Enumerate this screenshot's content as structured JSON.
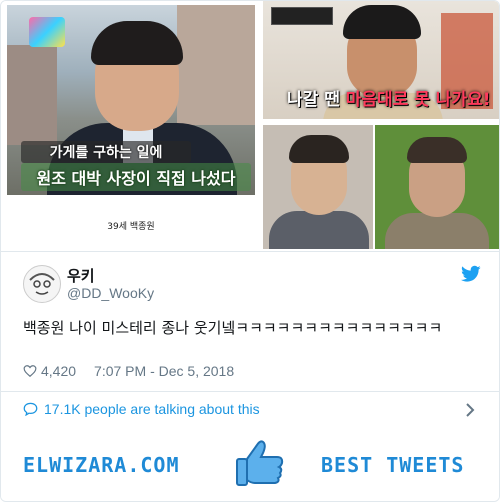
{
  "collage": {
    "photo1_caption_line1": "가게를 구하는 일에",
    "photo1_caption_line2": "원조 대박 사장이 직접 나섰다",
    "photo1_label": "39세 백종원",
    "photo2_caption_pre": "나갈 땐 ",
    "photo2_caption_highlight": "마음대로 못 나가요!"
  },
  "tweet": {
    "display_name": "우키",
    "handle": "@DD_WooKy",
    "text": "백종원 나이 미스테리 종나 웃기넼ㅋㅋㅋㅋㅋㅋㅋㅋㅋㅋㅋㅋㅋㅋㅋ",
    "likes": "4,420",
    "timestamp": "7:07 PM - Dec 5, 2018",
    "talking": "17.1K people are talking about this"
  },
  "footer": {
    "site": "ELWIZARA.COM",
    "tagline": "BEST TWEETS"
  },
  "colors": {
    "twitter_blue": "#1da1f2",
    "link_blue": "#1b95e0",
    "footer_blue": "#1f8ad6",
    "muted": "#657786"
  },
  "icons": [
    "twitter-bird-icon",
    "heart-icon",
    "comment-bubble-icon",
    "chevron-right-icon",
    "thumbs-up-icon"
  ]
}
